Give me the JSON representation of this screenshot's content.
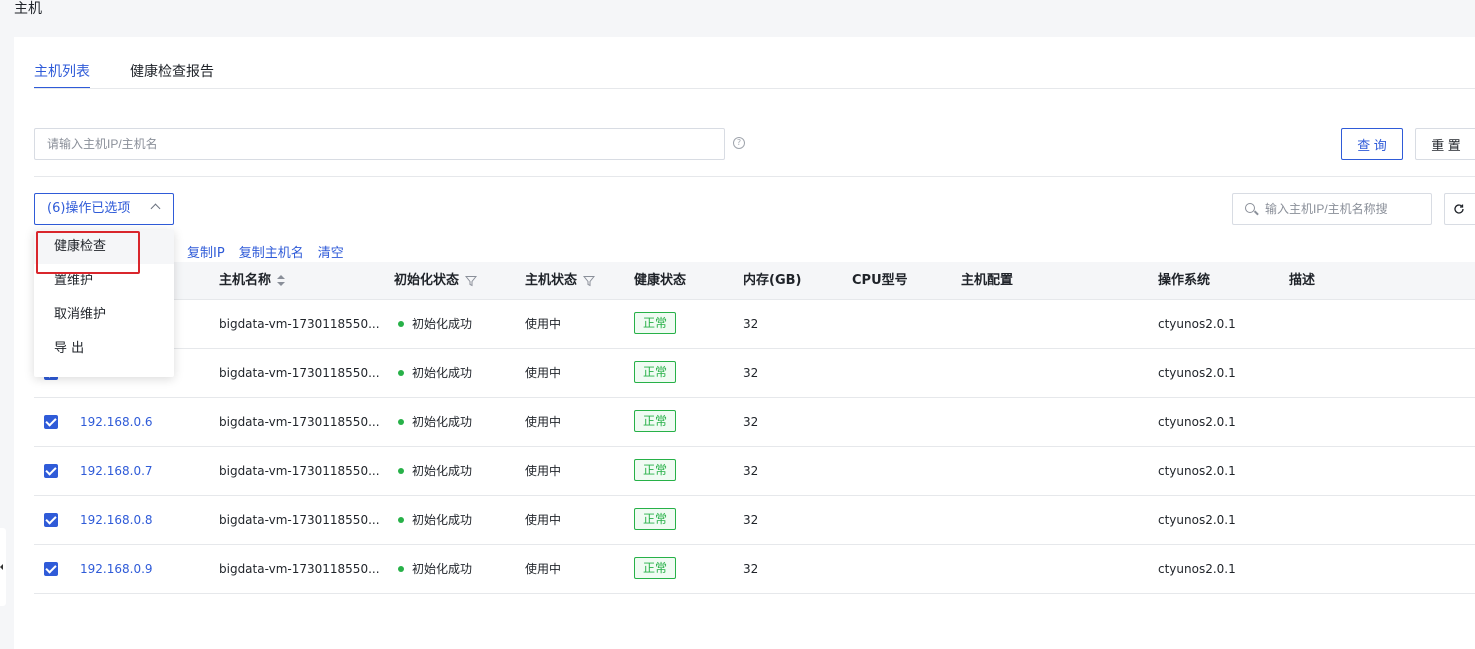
{
  "page": {
    "title": "主机"
  },
  "tabs": [
    {
      "label": "主机列表",
      "active": true
    },
    {
      "label": "健康检查报告",
      "active": false
    }
  ],
  "search": {
    "placeholder": "请输入主机IP/主机名",
    "help_icon": "?",
    "query_label": "查 询",
    "reset_label": "重 置"
  },
  "toolbar": {
    "op_select_label": "(6)操作已选项",
    "right_search_placeholder": "输入主机IP/主机名称搜",
    "refresh_icon": "refresh-icon",
    "links": [
      "复制IP",
      "复制主机名",
      "清空"
    ]
  },
  "dropdown": {
    "items": [
      "健康检查",
      "置维护",
      "取消维护",
      "导 出"
    ],
    "highlighted_index": 0
  },
  "table": {
    "columns": [
      "主机名称",
      "初始化状态",
      "主机状态",
      "健康状态",
      "内存(GB)",
      "CPU型号",
      "主机配置",
      "操作系统",
      "描述"
    ],
    "rows": [
      {
        "ip": "",
        "name": "bigdata-vm-1730118550...",
        "init": "初始化成功",
        "status": "使用中",
        "health": "正常",
        "mem": "32",
        "cpu": "",
        "config": "",
        "os": "ctyunos2.0.1",
        "desc": ""
      },
      {
        "ip": "",
        "name": "bigdata-vm-1730118550...",
        "init": "初始化成功",
        "status": "使用中",
        "health": "正常",
        "mem": "32",
        "cpu": "",
        "config": "",
        "os": "ctyunos2.0.1",
        "desc": ""
      },
      {
        "ip": "192.168.0.6",
        "name": "bigdata-vm-1730118550...",
        "init": "初始化成功",
        "status": "使用中",
        "health": "正常",
        "mem": "32",
        "cpu": "",
        "config": "",
        "os": "ctyunos2.0.1",
        "desc": ""
      },
      {
        "ip": "192.168.0.7",
        "name": "bigdata-vm-1730118550...",
        "init": "初始化成功",
        "status": "使用中",
        "health": "正常",
        "mem": "32",
        "cpu": "",
        "config": "",
        "os": "ctyunos2.0.1",
        "desc": ""
      },
      {
        "ip": "192.168.0.8",
        "name": "bigdata-vm-1730118550...",
        "init": "初始化成功",
        "status": "使用中",
        "health": "正常",
        "mem": "32",
        "cpu": "",
        "config": "",
        "os": "ctyunos2.0.1",
        "desc": ""
      },
      {
        "ip": "192.168.0.9",
        "name": "bigdata-vm-1730118550...",
        "init": "初始化成功",
        "status": "使用中",
        "health": "正常",
        "mem": "32",
        "cpu": "",
        "config": "",
        "os": "ctyunos2.0.1",
        "desc": ""
      }
    ]
  },
  "colors": {
    "primary": "#2f5bd8",
    "success": "#27b148",
    "highlight": "#d9262c"
  }
}
